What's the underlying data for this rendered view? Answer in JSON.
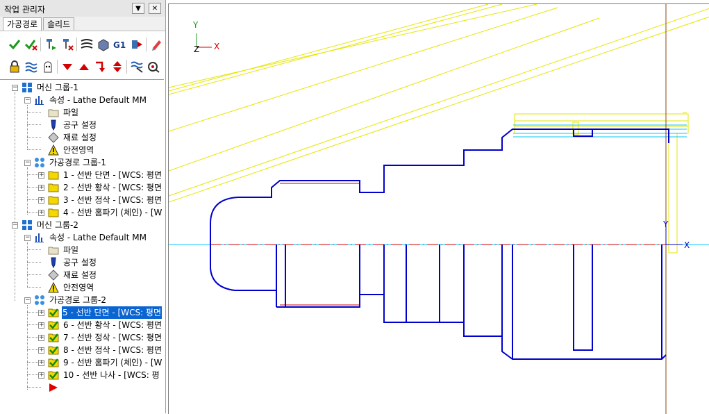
{
  "panel": {
    "title": "작업 관리자",
    "pin_label": "▼",
    "close_label": "✕",
    "tabs": [
      {
        "label": "가공경로"
      },
      {
        "label": "솔리드"
      }
    ]
  },
  "tree": {
    "groups": [
      {
        "machine_label": "머신 그룹-1",
        "props_label": "속성 - Lathe Default MM",
        "props_children": [
          "파일",
          "공구 설정",
          "재료 설정",
          "안전영역"
        ],
        "toolpath_group_label": "가공경로 그룹-1",
        "operations": [
          "1 - 선반 단면 - [WCS: 평면",
          "2 - 선반 황삭 - [WCS: 평면",
          "3 - 선반 정삭 - [WCS: 평면",
          "4 - 선반 홈파기 (체인) - [W"
        ]
      },
      {
        "machine_label": "머신 그룹-2",
        "props_label": "속성 - Lathe Default MM",
        "props_children": [
          "파일",
          "공구 설정",
          "재료 설정",
          "안전영역"
        ],
        "toolpath_group_label": "가공경로 그룹-2",
        "operations": [
          "5 - 선반 단면 - [WCS: 평면",
          "6 - 선반 황삭 - [WCS: 평면",
          "7 - 선반 정삭 - [WCS: 평면",
          "8 - 선반 정삭 - [WCS: 평면",
          "9 - 선반 홈파기 (체인) - [W",
          "10 - 선반 나사 - [WCS: 평"
        ]
      }
    ]
  },
  "viewport": {
    "triad": {
      "y": "Y",
      "x": "X",
      "z": "Z"
    },
    "wcs_axis": {
      "x": "X",
      "y": "Y"
    }
  },
  "colors": {
    "part_outline": "#0000cc",
    "stock_lines": "#e6e600",
    "centerline": "#00c8ff",
    "toolpath_red": "#cc0000",
    "selection": "#0a64d2"
  }
}
